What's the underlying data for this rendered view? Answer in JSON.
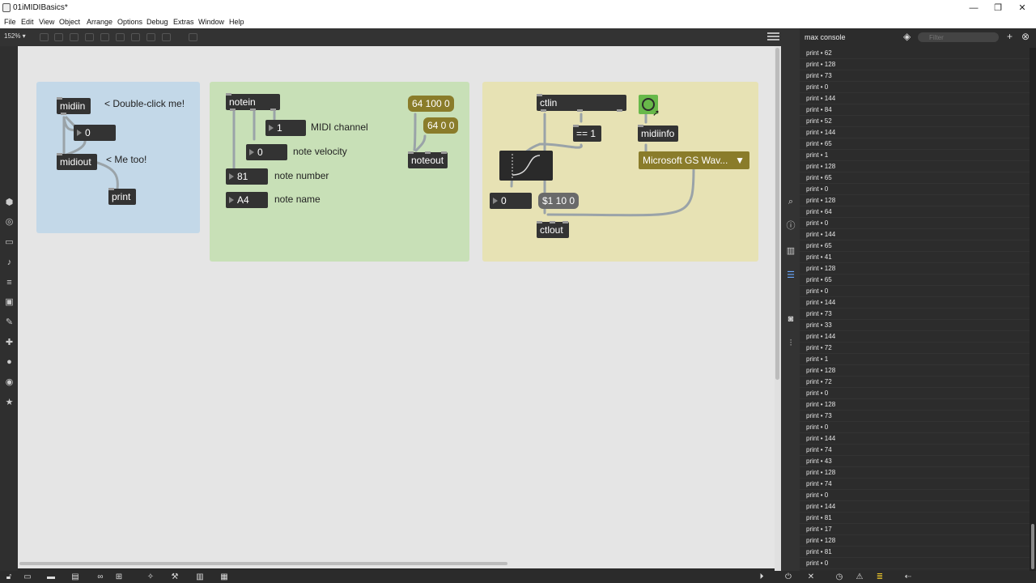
{
  "window": {
    "title": "01iMIDIBasics*",
    "minimize": "—",
    "maximize": "❐",
    "close": "✕"
  },
  "menu": [
    "File",
    "Edit",
    "View",
    "Object",
    "Arrange",
    "Options",
    "Debug",
    "Extras",
    "Window",
    "Help"
  ],
  "toolbar": {
    "zoom": "152% ▾"
  },
  "patch": {
    "panel1": {
      "color": "#c3d8e8",
      "midiin": "midiin",
      "midiout": "midiout",
      "print": "print",
      "number": "0",
      "comment_double_click": "< Double-click me!",
      "comment_me_too": "< Me too!"
    },
    "panel2": {
      "color": "#c8e0b7",
      "notein": "notein",
      "channel_num": "1",
      "velocity_num": "0",
      "note_num": "81",
      "note_name": "A4",
      "label_channel": "MIDI channel",
      "label_velocity": "note velocity",
      "label_number": "note number",
      "label_name": "note name",
      "msg1": "64 100 0",
      "msg2": "64 0 0",
      "noteout": "noteout"
    },
    "panel3": {
      "color": "#e7e2b4",
      "ctlin": "ctlin",
      "eq": "== 1",
      "midiinfo": "midiinfo",
      "menu_value": "Microsoft GS Wav...",
      "number": "0",
      "msg": "$1 10 0",
      "ctlout": "ctlout"
    }
  },
  "console": {
    "title": "max console",
    "filter_placeholder": "Filter",
    "lines": [
      "print • 62",
      "print • 128",
      "print • 73",
      "print • 0",
      "print • 144",
      "print • 84",
      "print • 52",
      "print • 144",
      "print • 65",
      "print • 1",
      "print • 128",
      "print • 65",
      "print • 0",
      "print • 128",
      "print • 64",
      "print • 0",
      "print • 144",
      "print • 65",
      "print • 41",
      "print • 128",
      "print • 65",
      "print • 0",
      "print • 144",
      "print • 73",
      "print • 33",
      "print • 144",
      "print • 72",
      "print • 1",
      "print • 128",
      "print • 72",
      "print • 0",
      "print • 128",
      "print • 73",
      "print • 0",
      "print • 144",
      "print • 74",
      "print • 43",
      "print • 128",
      "print • 74",
      "print • 0",
      "print • 144",
      "print • 81",
      "print • 17",
      "print • 128",
      "print • 81",
      "print • 0"
    ]
  }
}
